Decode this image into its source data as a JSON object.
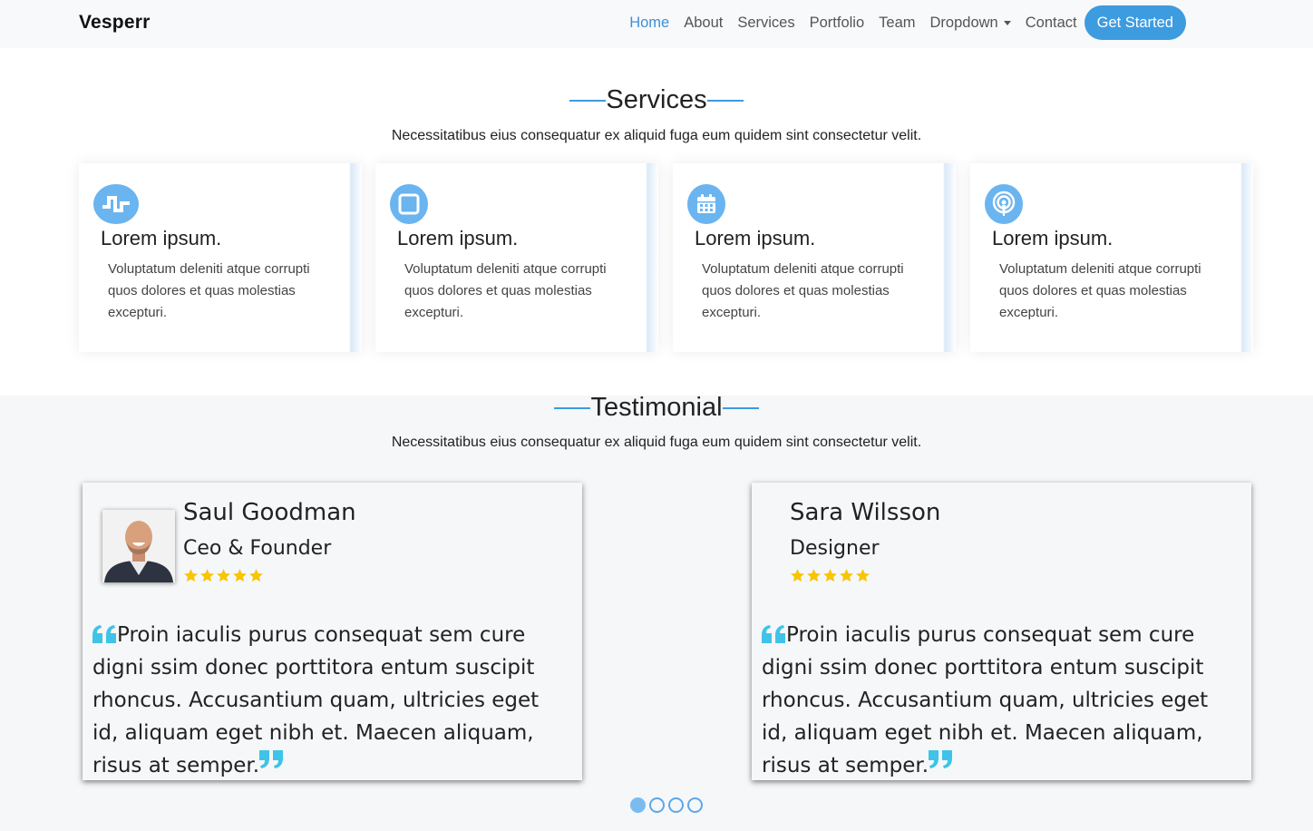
{
  "nav": {
    "brand": "Vesperr",
    "links": [
      "Home",
      "About",
      "Services",
      "Portfolio",
      "Team",
      "Dropdown",
      "Contact"
    ],
    "active": "Home",
    "cta": "Get Started"
  },
  "services": {
    "title": "Services",
    "subtitle": "Necessitatibus eius consequatur ex aliquid fuga eum quidem sint consectetur velit.",
    "items": [
      {
        "icon": "activity-icon",
        "title": "Lorem ipsum.",
        "text": "Voluptatum deleniti atque corrupti quos dolores et quas molestias excepturi."
      },
      {
        "icon": "square-icon",
        "title": "Lorem ipsum.",
        "text": "Voluptatum deleniti atque corrupti quos dolores et quas molestias excepturi."
      },
      {
        "icon": "calendar-icon",
        "title": "Lorem ipsum.",
        "text": "Voluptatum deleniti atque corrupti quos dolores et quas molestias excepturi."
      },
      {
        "icon": "broadcast-icon",
        "title": "Lorem ipsum.",
        "text": "Voluptatum deleniti atque corrupti quos dolores et quas molestias excepturi."
      }
    ]
  },
  "testimonial": {
    "title": "Testimonial",
    "subtitle": "Necessitatibus eius consequatur ex aliquid fuga eum quidem sint consectetur velit.",
    "items": [
      {
        "name": "Saul Goodman",
        "role": "Ceo & Founder",
        "rating": 5,
        "quote": "Proin iaculis purus consequat sem cure digni ssim donec porttitora entum suscipit rhoncus. Accusantium quam, ultricies eget id, aliquam eget nibh et. Maecen aliquam, risus at semper."
      },
      {
        "name": "Sara Wilsson",
        "role": "Designer",
        "rating": 5,
        "quote": "Proin iaculis purus consequat sem cure digni ssim donec porttitora entum suscipit rhoncus. Accusantium quam, ultricies eget id, aliquam eget nibh et. Maecen aliquam, risus at semper."
      }
    ],
    "pages": 4,
    "current_page": 1
  },
  "colors": {
    "accent": "#3d9be0",
    "icon_bg": "#6ab4f0",
    "star": "#f7c600",
    "quote": "#3fc3e8"
  }
}
